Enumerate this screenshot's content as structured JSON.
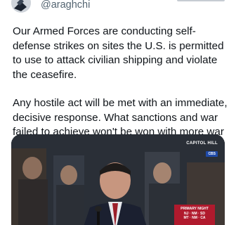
{
  "post": {
    "handle": "@araghchi",
    "paragraphs": [
      "Our Armed Forces are conducting self-defense strikes on sites the U.S. is permitted to use to attack civilian shipping and violate the ceasefire.",
      "Any hostile act will be met with an immediate, decisive response. What sanctions and war failed to achieve won't be won with more war"
    ]
  },
  "media": {
    "logo_text": "CAPITOL HILL",
    "logo_badge": "CBS",
    "overlay_lines": [
      "PRIMARY NIGHT",
      "NJ · NM · SD",
      "MT · NM · CA"
    ]
  },
  "colors": {
    "text": "#0f1419",
    "secondary": "#536471",
    "overlay_red": "#b01a2d"
  }
}
